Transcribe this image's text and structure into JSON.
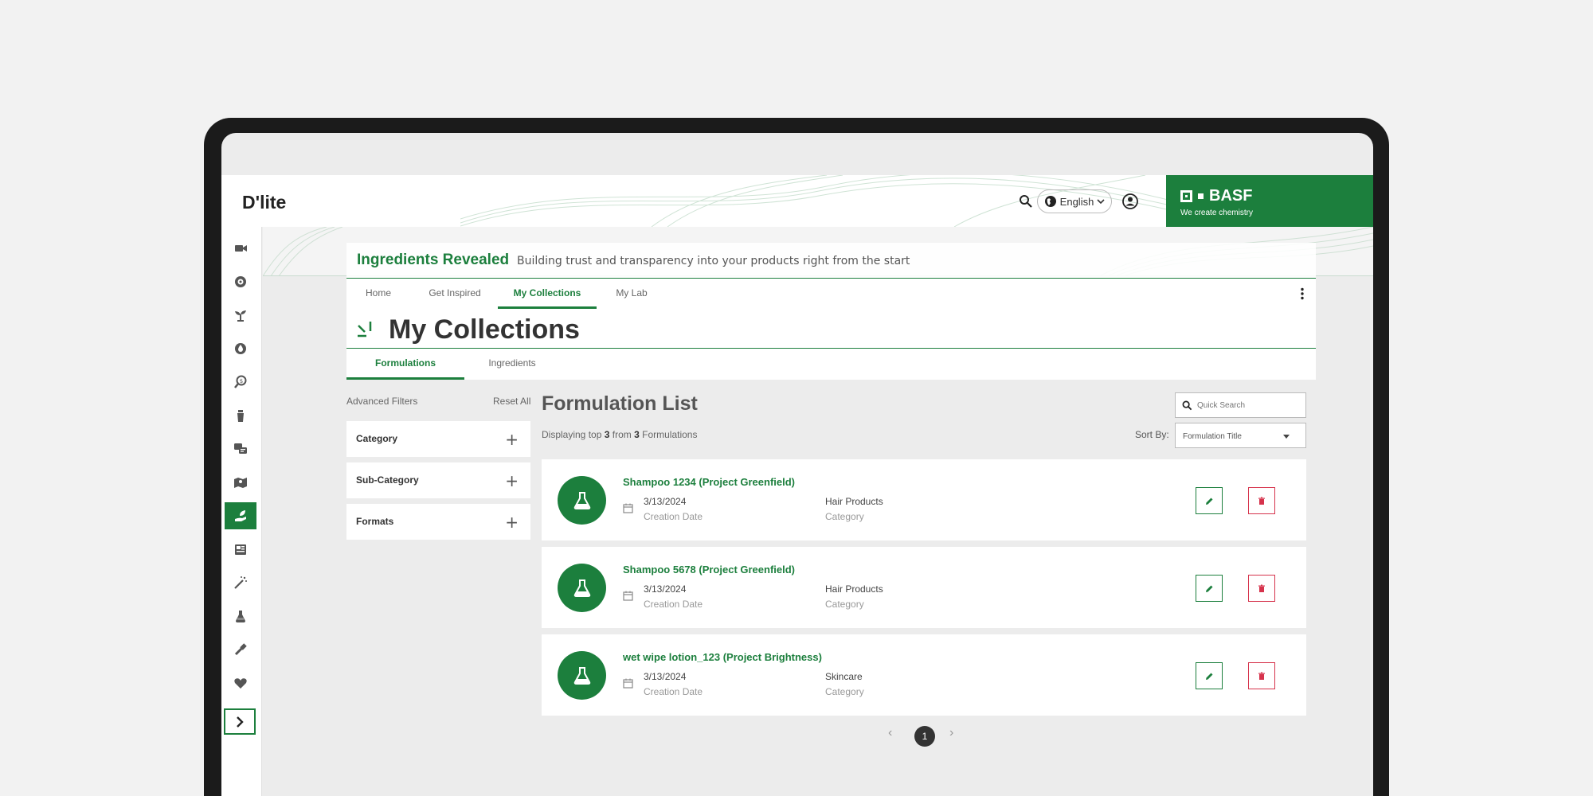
{
  "header": {
    "app_name": "D'lite",
    "language": "English",
    "brand_name": "BASF",
    "brand_tagline": "We create chemistry"
  },
  "sidebar": {
    "icons": [
      "video-icon",
      "target-icon",
      "sprout-icon",
      "drop-icon",
      "search-dollar-icon",
      "bottle-icon",
      "chat-icon",
      "map-icon",
      "hand-leaf-icon",
      "newspaper-icon",
      "magic-wand-icon",
      "flask-icon",
      "pipette-icon",
      "heart-icon"
    ],
    "active_index": 8,
    "expand_icon": "chevron-right-icon"
  },
  "banner": {
    "title": "Ingredients Revealed",
    "subtitle": "Building trust and transparency into your products right from the start"
  },
  "nav": {
    "tabs": [
      "Home",
      "Get Inspired",
      "My Collections",
      "My Lab"
    ],
    "active": "My Collections"
  },
  "page": {
    "title": "My Collections"
  },
  "subtabs": {
    "tabs": [
      "Formulations",
      "Ingredients"
    ],
    "active": "Formulations"
  },
  "filters": {
    "heading": "Advanced Filters",
    "reset_label": "Reset All",
    "groups": [
      "Category",
      "Sub-Category",
      "Formats"
    ]
  },
  "list": {
    "title": "Formulation List",
    "display_prefix": "Displaying top",
    "display_count": "3",
    "display_mid": "from",
    "display_total": "3",
    "display_suffix": "Formulations",
    "search_placeholder": "Quick Search",
    "sort_label": "Sort By:",
    "sort_value": "Formulation Title",
    "date_label": "Creation Date",
    "category_label": "Category",
    "items": [
      {
        "title": "Shampoo 1234 (Project Greenfield)",
        "date": "3/13/2024",
        "category": "Hair Products"
      },
      {
        "title": "Shampoo 5678 (Project Greenfield)",
        "date": "3/13/2024",
        "category": "Hair Products"
      },
      {
        "title": "wet wipe lotion_123 (Project Brightness)",
        "date": "3/13/2024",
        "category": "Skincare"
      }
    ]
  },
  "pagination": {
    "current": "1",
    "prev": "‹",
    "next": "›"
  },
  "colors": {
    "brand_green": "#1c7f3d",
    "delete_red": "#d6334c"
  }
}
